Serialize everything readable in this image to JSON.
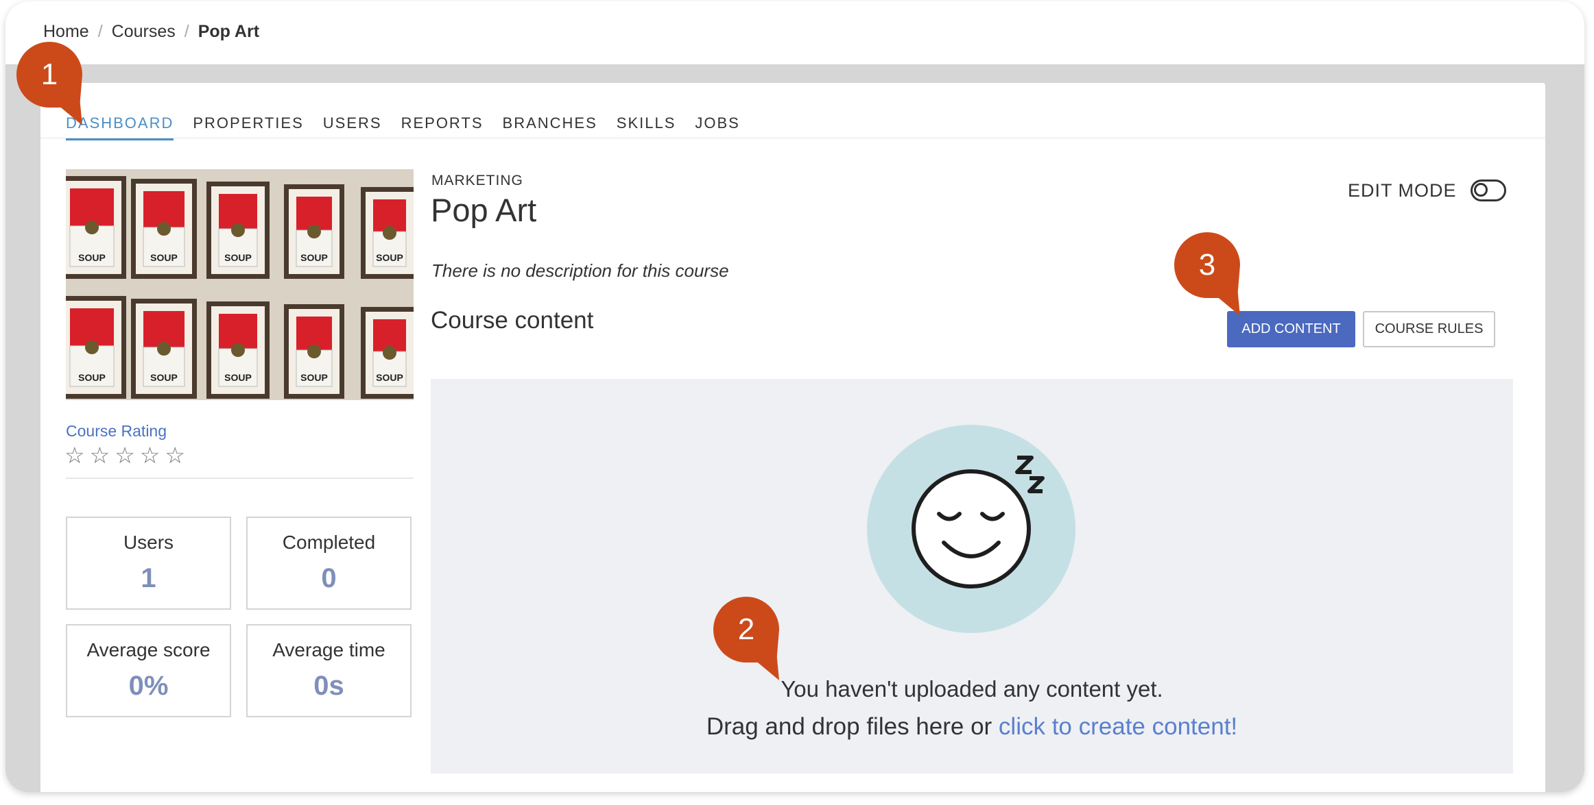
{
  "breadcrumb": {
    "home": "Home",
    "courses": "Courses",
    "current": "Pop Art",
    "separator": "/"
  },
  "tabs": [
    "DASHBOARD",
    "PROPERTIES",
    "USERS",
    "REPORTS",
    "BRANCHES",
    "SKILLS",
    "JOBS"
  ],
  "course": {
    "category": "MARKETING",
    "title": "Pop Art",
    "description": "There is no description for this course"
  },
  "rating": {
    "label": "Course Rating",
    "star_glyph": "☆",
    "value": 0,
    "max": 5
  },
  "stats": [
    {
      "label": "Users",
      "value": "1"
    },
    {
      "label": "Completed",
      "value": "0"
    },
    {
      "label": "Average score",
      "value": "0%"
    },
    {
      "label": "Average time",
      "value": "0s"
    }
  ],
  "edit_mode": {
    "label": "EDIT MODE",
    "enabled": false
  },
  "content": {
    "section_title": "Course content",
    "add_button": "ADD CONTENT",
    "rules_button": "COURSE RULES",
    "empty_message": "You haven't uploaded any content yet.",
    "drag_prefix": "Drag and drop files here or ",
    "create_link": "click to create content!"
  },
  "callouts": [
    "1",
    "2",
    "3"
  ],
  "colors": {
    "accent": "#4a8fc7",
    "primary_button": "#4a69bf",
    "link": "#5a7fcd",
    "stat_value": "#7e8fba",
    "callout": "#cc4a1a",
    "illustration_circle": "#c5e0e5"
  },
  "thumbnail": {
    "description": "grid of soup can paintings",
    "labels": [
      "SOUP",
      "SOUP",
      "SOUP",
      "SOUP",
      "SOUP",
      "SOUP",
      "SOUP",
      "SOUP",
      "SOUP",
      "SOUP"
    ]
  }
}
